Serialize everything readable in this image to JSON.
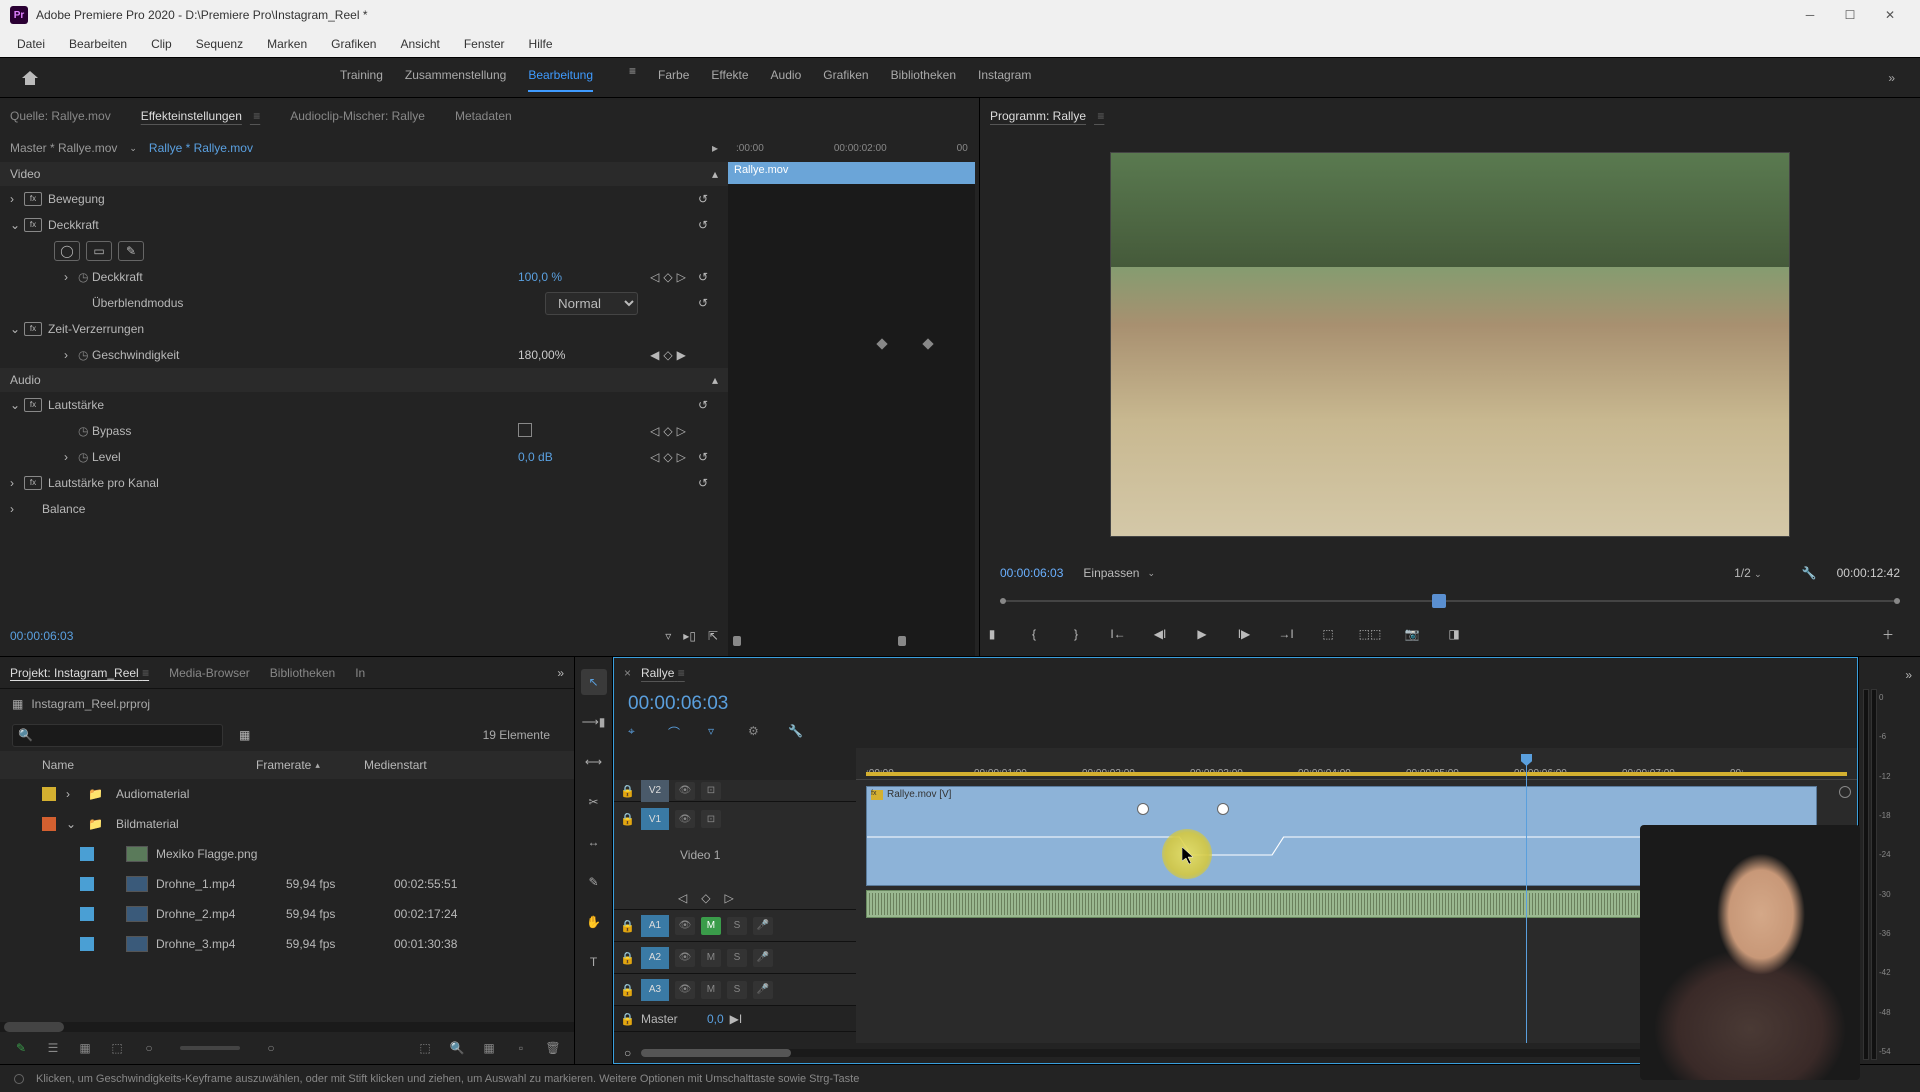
{
  "titlebar": {
    "app": "Adobe Premiere Pro 2020",
    "path": "D:\\Premiere Pro\\Instagram_Reel *"
  },
  "menu": [
    "Datei",
    "Bearbeiten",
    "Clip",
    "Sequenz",
    "Marken",
    "Grafiken",
    "Ansicht",
    "Fenster",
    "Hilfe"
  ],
  "workspaces": [
    "Training",
    "Zusammenstellung",
    "Bearbeitung",
    "Farbe",
    "Effekte",
    "Audio",
    "Grafiken",
    "Bibliotheken",
    "Instagram"
  ],
  "workspace_active": 2,
  "source_tabs": {
    "items": [
      "Quelle: Rallye.mov",
      "Effekteinstellungen",
      "Audioclip-Mischer: Rallye",
      "Metadaten"
    ],
    "active": 1
  },
  "effect_controls": {
    "master_label": "Master * Rallye.mov",
    "clip_label": "Rallye * Rallye.mov",
    "timeline_ruler": [
      ":00:00",
      "00:00:02:00",
      "00"
    ],
    "clip_name": "Rallye.mov",
    "video_hdr": "Video",
    "audio_hdr": "Audio",
    "bewegung": "Bewegung",
    "deckkraft": "Deckkraft",
    "deckkraft_val": "100,0 %",
    "blend_label": "Überblendmodus",
    "blend_val": "Normal",
    "zeit": "Zeit-Verzerrungen",
    "geschw": "Geschwindigkeit",
    "geschw_val": "180,00%",
    "laut": "Lautstärke",
    "bypass": "Bypass",
    "level": "Level",
    "level_val": "0,0 dB",
    "laut_kanal": "Lautstärke pro Kanal",
    "balance": "Balance",
    "foot_tc": "00:00:06:03"
  },
  "program": {
    "label": "Programm: Rallye",
    "tc": "00:00:06:03",
    "fit": "Einpassen",
    "frac": "1/2",
    "dur": "00:00:12:42"
  },
  "project": {
    "tabs": [
      "Projekt: Instagram_Reel",
      "Media-Browser",
      "Bibliotheken",
      "In"
    ],
    "name": "Instagram_Reel.prproj",
    "count": "19 Elemente",
    "cols": [
      "Name",
      "Framerate",
      "Medienstart"
    ],
    "rows": [
      {
        "swatch": "#d4b030",
        "type": "folder",
        "name": "Audiomaterial",
        "fr": "",
        "ms": "",
        "indent": 1,
        "expand": true
      },
      {
        "swatch": "#d46030",
        "type": "folder",
        "name": "Bildmaterial",
        "fr": "",
        "ms": "",
        "indent": 1,
        "expand": true,
        "open": true
      },
      {
        "swatch": "#4a9fd4",
        "type": "image",
        "name": "Mexiko Flagge.png",
        "fr": "",
        "ms": "",
        "indent": 2
      },
      {
        "swatch": "#4a9fd4",
        "type": "clip",
        "name": "Drohne_1.mp4",
        "fr": "59,94 fps",
        "ms": "00:02:55:51",
        "indent": 2
      },
      {
        "swatch": "#4a9fd4",
        "type": "clip",
        "name": "Drohne_2.mp4",
        "fr": "59,94 fps",
        "ms": "00:02:17:24",
        "indent": 2
      },
      {
        "swatch": "#4a9fd4",
        "type": "clip",
        "name": "Drohne_3.mp4",
        "fr": "59,94 fps",
        "ms": "00:01:30:38",
        "indent": 2
      }
    ]
  },
  "timeline": {
    "seq": "Rallye",
    "tc": "00:00:06:03",
    "ruler": [
      ":00:00",
      "00:00:01:00",
      "00:00:02:00",
      "00:00:03:00",
      "00:00:04:00",
      "00:00:05:00",
      "00:00:06:00",
      "00:00:07:00",
      "00:"
    ],
    "tracks": {
      "v2": "V2",
      "v1": "V1",
      "v1_full": "Video 1",
      "a1": "A1",
      "a2": "A2",
      "a3": "A3",
      "master": "Master",
      "master_val": "0,0",
      "m": "M",
      "s": "S"
    },
    "clip": "Rallye.mov [V]"
  },
  "status": "Klicken, um Geschwindigkeits-Keyframe auszuwählen, oder mit Stift klicken und ziehen, um Auswahl zu markieren. Weitere Optionen mit Umschalttaste sowie Strg-Taste",
  "meter_scale": [
    "0",
    "-6",
    "-12",
    "-18",
    "-24",
    "-30",
    "-36",
    "-42",
    "-48",
    "-54"
  ]
}
